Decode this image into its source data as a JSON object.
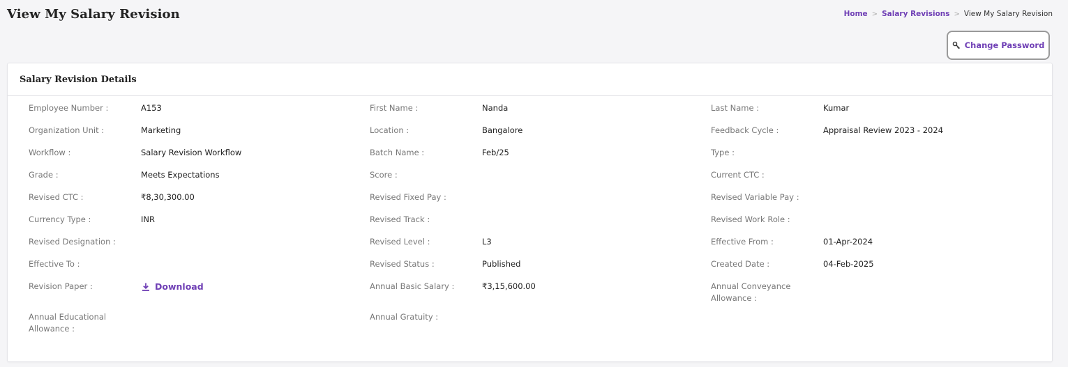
{
  "header": {
    "title": "View My Salary Revision",
    "breadcrumb": {
      "home": "Home",
      "separator": ">",
      "parent": "Salary Revisions",
      "current": "View My Salary Revision"
    },
    "change_password_label": "Change Password",
    "change_password_icon": "key-icon"
  },
  "card": {
    "title": "Salary Revision Details",
    "rows": [
      [
        {
          "label": "Employee Number :",
          "value": "A153"
        },
        {
          "label": "First Name :",
          "value": "Nanda"
        },
        {
          "label": "Last Name :",
          "value": "Kumar"
        }
      ],
      [
        {
          "label": "Organization Unit :",
          "value": "Marketing"
        },
        {
          "label": "Location :",
          "value": "Bangalore"
        },
        {
          "label": "Feedback Cycle :",
          "value": "Appraisal Review 2023 - 2024"
        }
      ],
      [
        {
          "label": "Workflow :",
          "value": "Salary Revision Workflow"
        },
        {
          "label": "Batch Name :",
          "value": "Feb/25"
        },
        {
          "label": "Type :",
          "value": ""
        }
      ],
      [
        {
          "label": "Grade :",
          "value": "Meets Expectations"
        },
        {
          "label": "Score :",
          "value": ""
        },
        {
          "label": "Current CTC :",
          "value": ""
        }
      ],
      [
        {
          "label": "Revised CTC :",
          "value": "₹8,30,300.00"
        },
        {
          "label": "Revised Fixed Pay :",
          "value": ""
        },
        {
          "label": "Revised Variable Pay :",
          "value": ""
        }
      ],
      [
        {
          "label": "Currency Type :",
          "value": "INR"
        },
        {
          "label": "Revised Track :",
          "value": ""
        },
        {
          "label": "Revised Work Role :",
          "value": ""
        }
      ],
      [
        {
          "label": "Revised Designation :",
          "value": ""
        },
        {
          "label": "Revised Level :",
          "value": "L3"
        },
        {
          "label": "Effective From :",
          "value": "01-Apr-2024"
        }
      ],
      [
        {
          "label": "Effective To :",
          "value": ""
        },
        {
          "label": "Revised Status :",
          "value": "Published"
        },
        {
          "label": "Created Date :",
          "value": "04-Feb-2025"
        }
      ]
    ],
    "revision_paper_label": "Revision Paper :",
    "download_label": "Download",
    "download_icon": "download-icon",
    "annual_basic_label": "Annual Basic Salary :",
    "annual_basic_value": "₹3,15,600.00",
    "annual_conveyance_label": "Annual Conveyance Allowance :",
    "annual_educational_label": "Annual Educational Allowance :",
    "annual_gratuity_label": "Annual Gratuity :"
  },
  "colors": {
    "accent": "#6f3fb5",
    "label": "#777777",
    "value": "#222222"
  }
}
